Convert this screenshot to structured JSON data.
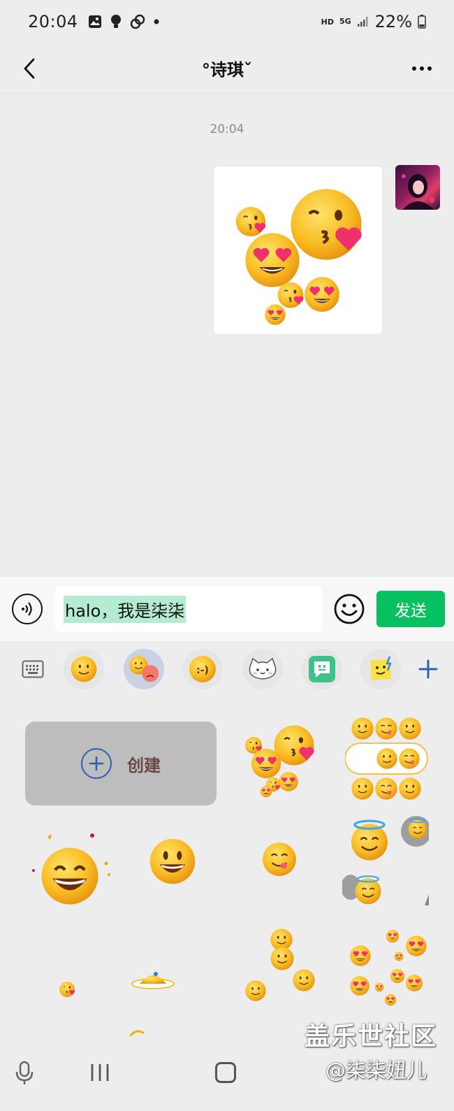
{
  "status_bar": {
    "time": "20:04",
    "network_hd": "HD",
    "network_5g": "5G",
    "battery": "22%",
    "icons": [
      "image-icon",
      "bulb-icon",
      "link-icon",
      "dot-icon",
      "signal-icon",
      "battery-icon"
    ]
  },
  "nav": {
    "title": "°诗琪ˇ",
    "icons": [
      "back-arrow-icon",
      "more-icon"
    ]
  },
  "chat": {
    "timestamp": "20:04",
    "message_type": "sticker"
  },
  "input": {
    "text": "halo，我是柒柒",
    "send_label": "发送"
  },
  "sticker_tabs": {
    "items": [
      "keyboard-icon",
      "smile-emoji",
      "mood-emoji",
      "text-emoticon",
      "cat-sticker",
      "chat-bot-sticker",
      "card-sticker",
      "add-icon"
    ],
    "text_emoticon": ":-)",
    "active_index": 2
  },
  "grid": {
    "create_label": "创建"
  },
  "watermark": {
    "line1": "盖乐世社区",
    "line2": "@柒柒妞儿"
  },
  "colors": {
    "accent_green": "#07c160",
    "selection_highlight": "#b4ecd2",
    "active_tab": "#cbd1e4",
    "emoji_yellow": "#f6b820"
  }
}
